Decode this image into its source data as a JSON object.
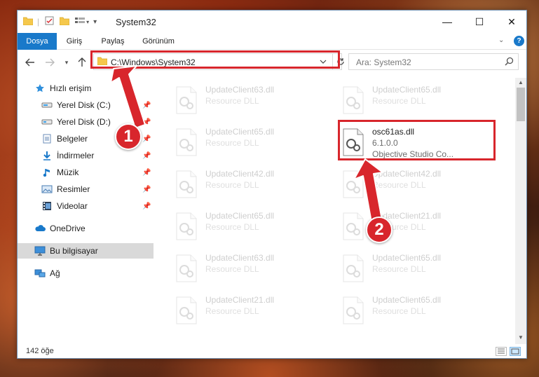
{
  "window": {
    "title": "System32",
    "controls": {
      "minimize": "—",
      "maximize": "☐",
      "close": "✕"
    }
  },
  "ribbon": {
    "tabs": [
      {
        "label": "Dosya",
        "active": true
      },
      {
        "label": "Giriş",
        "active": false
      },
      {
        "label": "Paylaş",
        "active": false
      },
      {
        "label": "Görünüm",
        "active": false
      }
    ],
    "help": "?"
  },
  "nav": {
    "address": "C:\\Windows\\System32",
    "search_placeholder": "Ara: System32"
  },
  "sidebar": {
    "quick_access": "Hızlı erişim",
    "pinned": [
      {
        "label": "Yerel Disk (C:)",
        "icon": "drive-icon"
      },
      {
        "label": "Yerel Disk (D:)",
        "icon": "drive-icon"
      },
      {
        "label": "Belgeler",
        "icon": "documents-icon"
      },
      {
        "label": "İndirmeler",
        "icon": "downloads-icon"
      },
      {
        "label": "Müzik",
        "icon": "music-icon"
      },
      {
        "label": "Resimler",
        "icon": "pictures-icon"
      },
      {
        "label": "Videolar",
        "icon": "videos-icon"
      }
    ],
    "onedrive": "OneDrive",
    "this_pc": "Bu bilgisayar",
    "network": "Ağ"
  },
  "files": {
    "left_column": [
      {
        "name": "UpdateClient63.dll",
        "type": "Resource DLL"
      },
      {
        "name": "UpdateClient65.dll",
        "type": "Resource DLL"
      },
      {
        "name": "UpdateClient42.dll",
        "type": "Resource DLL"
      },
      {
        "name": "UpdateClient65.dll",
        "type": "Resource DLL"
      },
      {
        "name": "UpdateClient63.dll",
        "type": "Resource DLL"
      },
      {
        "name": "UpdateClient21.dll",
        "type": "Resource DLL"
      }
    ],
    "right_column": [
      {
        "name": "UpdateClient65.dll",
        "type": "Resource DLL"
      },
      {
        "name": "osc61as.dll",
        "version": "6.1.0.0",
        "company": "Objective Studio Co..."
      },
      {
        "name": "UpdateClient42.dll",
        "type": "Resource DLL"
      },
      {
        "name": "UpdateClient21.dll",
        "type": "Resource DLL"
      },
      {
        "name": "UpdateClient65.dll",
        "type": "Resource DLL"
      },
      {
        "name": "UpdateClient65.dll",
        "type": "Resource DLL"
      }
    ]
  },
  "status": {
    "item_count": "142 öğe"
  },
  "annotations": {
    "step1": "1",
    "step2": "2",
    "accent": "#d8262c"
  }
}
